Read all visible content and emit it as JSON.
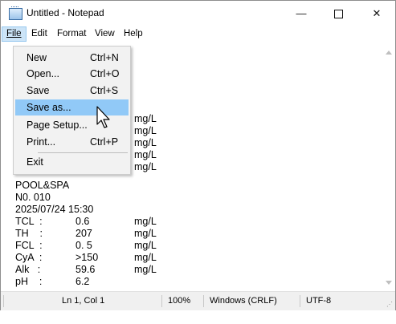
{
  "window": {
    "title": "Untitled - Notepad",
    "controls": {
      "minimize": "—",
      "close": "✕"
    }
  },
  "menubar": [
    {
      "label": "File"
    },
    {
      "label": "Edit"
    },
    {
      "label": "Format"
    },
    {
      "label": "View"
    },
    {
      "label": "Help"
    }
  ],
  "file_menu": {
    "items": [
      {
        "label": "New",
        "shortcut": "Ctrl+N"
      },
      {
        "label": "Open...",
        "shortcut": "Ctrl+O"
      },
      {
        "label": "Save",
        "shortcut": "Ctrl+S"
      },
      {
        "label": "Save as...",
        "shortcut": ""
      },
      {
        "label": "Page Setup...",
        "shortcut": ""
      },
      {
        "label": "Print...",
        "shortcut": "Ctrl+P"
      },
      {
        "label": "Exit",
        "shortcut": ""
      }
    ]
  },
  "document": {
    "partial_lines": [
      "mg/L",
      "mg/L",
      "mg/L",
      "mg/L",
      "mg/L"
    ],
    "lines": [
      {
        "a": "POOL&SPA",
        "b": "",
        "c": ""
      },
      {
        "a": "N0. 010",
        "b": "",
        "c": ""
      },
      {
        "a": "2025/07/24 15:30",
        "b": "",
        "c": ""
      },
      {
        "a": "TCL  :",
        "b": "0.6",
        "c": "mg/L"
      },
      {
        "a": "TH    :",
        "b": "207",
        "c": "mg/L"
      },
      {
        "a": "FCL  :",
        "b": "0. 5",
        "c": "mg/L"
      },
      {
        "a": "CyA  :",
        "b": ">150",
        "c": "mg/L"
      },
      {
        "a": "Alk   :",
        "b": "59.6",
        "c": "mg/L"
      },
      {
        "a": "pH    :",
        "b": "6.2",
        "c": ""
      }
    ]
  },
  "statusbar": {
    "position": "Ln 1, Col 1",
    "zoom": "100%",
    "line_ending": "Windows (CRLF)",
    "encoding": "UTF-8"
  },
  "colors": {
    "menu_highlight": "#91c9f7",
    "menubar_active": "#cce4f7",
    "status_bg": "#f0f0f0"
  }
}
